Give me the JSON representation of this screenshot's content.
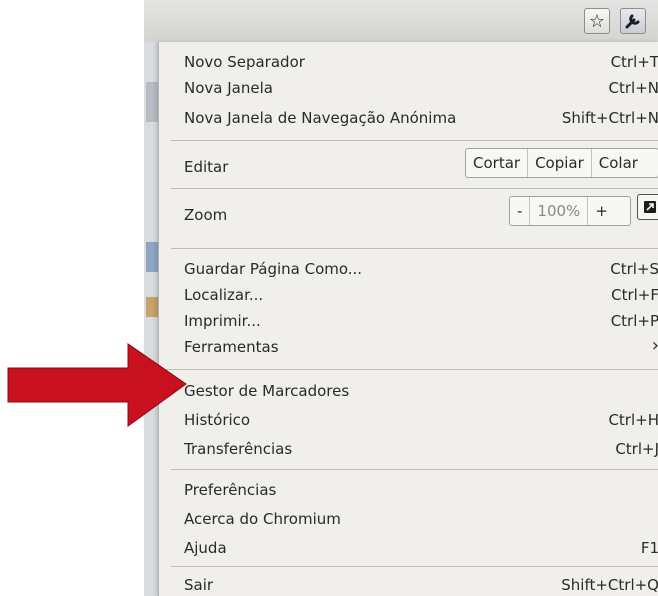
{
  "toolbar": {
    "bookmark_icon": "star-icon",
    "menu_icon": "wrench-icon"
  },
  "menu": {
    "new_tab": {
      "label": "Novo Separador",
      "shortcut": "Ctrl+T"
    },
    "new_window": {
      "label": "Nova Janela",
      "shortcut": "Ctrl+N"
    },
    "incognito": {
      "label": "Nova Janela de Navegação Anónima",
      "shortcut": "Shift+Ctrl+N"
    },
    "edit": {
      "label": "Editar",
      "cut": "Cortar",
      "copy": "Copiar",
      "paste": "Colar"
    },
    "zoom": {
      "label": "Zoom",
      "minus": "-",
      "level": "100%",
      "plus": "+"
    },
    "save_page": {
      "label": "Guardar Página Como...",
      "shortcut": "Ctrl+S"
    },
    "find": {
      "label": "Localizar...",
      "shortcut": "Ctrl+F"
    },
    "print": {
      "label": "Imprimir...",
      "shortcut": "Ctrl+P"
    },
    "tools": {
      "label": "Ferramentas",
      "shortcut": "›"
    },
    "bookmark_manager": {
      "label": "Gestor de Marcadores"
    },
    "history": {
      "label": "Histórico",
      "shortcut": "Ctrl+H"
    },
    "downloads": {
      "label": "Transferências",
      "shortcut": "Ctrl+J"
    },
    "preferences": {
      "label": "Preferências"
    },
    "about": {
      "label": "Acerca do Chromium"
    },
    "help": {
      "label": "Ajuda",
      "shortcut": "F1"
    },
    "exit": {
      "label": "Sair",
      "shortcut": "Shift+Ctrl+Q"
    }
  },
  "annotation": {
    "arrow_color": "#c8101e"
  }
}
